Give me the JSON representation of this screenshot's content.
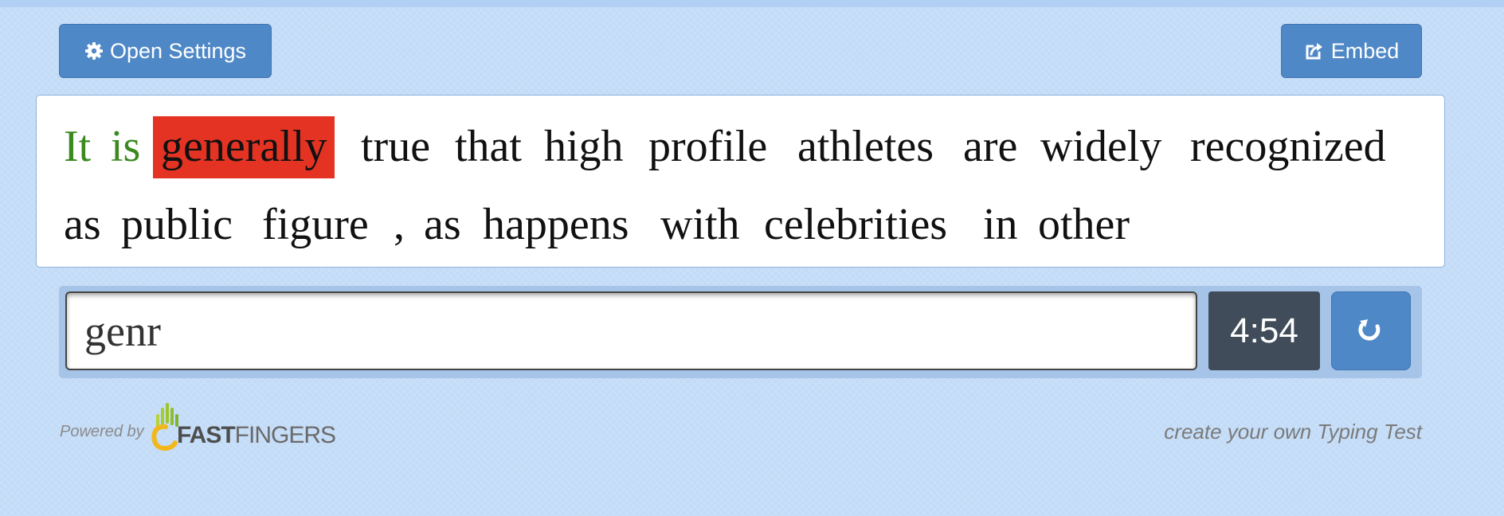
{
  "toolbar": {
    "settings_label": "Open Settings",
    "settings_icon": "gear-icon",
    "embed_label": "Embed",
    "embed_icon": "share-icon"
  },
  "words": [
    {
      "text": "It",
      "state": "correct"
    },
    {
      "text": "is",
      "state": "correct"
    },
    {
      "text": "generally",
      "state": "current"
    },
    {
      "text": "true",
      "state": "pending"
    },
    {
      "text": "that",
      "state": "pending"
    },
    {
      "text": "high",
      "state": "pending"
    },
    {
      "text": "profile",
      "state": "pending"
    },
    {
      "text": "athletes",
      "state": "pending"
    },
    {
      "text": "are",
      "state": "pending"
    },
    {
      "text": "widely",
      "state": "pending"
    },
    {
      "text": "recognized",
      "state": "pending"
    },
    {
      "text": "as",
      "state": "pending"
    },
    {
      "text": "public",
      "state": "pending"
    },
    {
      "text": "figure",
      "state": "pending"
    },
    {
      "text": ",",
      "state": "pending"
    },
    {
      "text": "as",
      "state": "pending"
    },
    {
      "text": "happens",
      "state": "pending"
    },
    {
      "text": "with",
      "state": "pending"
    },
    {
      "text": "celebrities",
      "state": "pending"
    },
    {
      "text": "in",
      "state": "pending"
    },
    {
      "text": "other",
      "state": "pending"
    }
  ],
  "typing": {
    "value": "genr"
  },
  "timer": {
    "value": "4:54"
  },
  "reload": {
    "icon": "reload-icon"
  },
  "footer": {
    "powered_by": "Powered by",
    "logo_fast": "FAST",
    "logo_fingers": "FINGERS",
    "create_link": "create your own Typing Test"
  },
  "colors": {
    "background": "#c2dbf7",
    "button": "#4f88c7",
    "correct_word": "#3a8a1f",
    "current_word_highlight": "#e43323",
    "timer_bg": "#414c5a"
  }
}
